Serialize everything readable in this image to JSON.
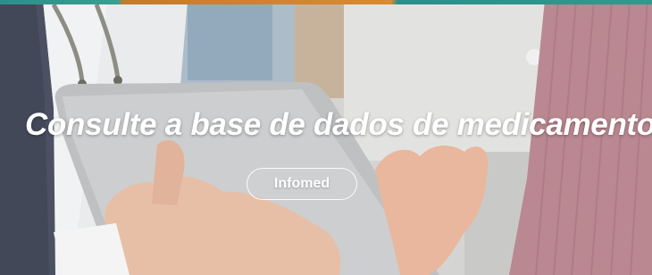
{
  "banner": {
    "title": "Consulte a base de dados de medicamentos",
    "button_label": "Infomed",
    "image_description_icon": "doctor-with-tablet-photo"
  },
  "colors": {
    "top_strip_teal": "#2a8f8b",
    "top_strip_orange": "#d98a33",
    "text": "#ffffff"
  }
}
